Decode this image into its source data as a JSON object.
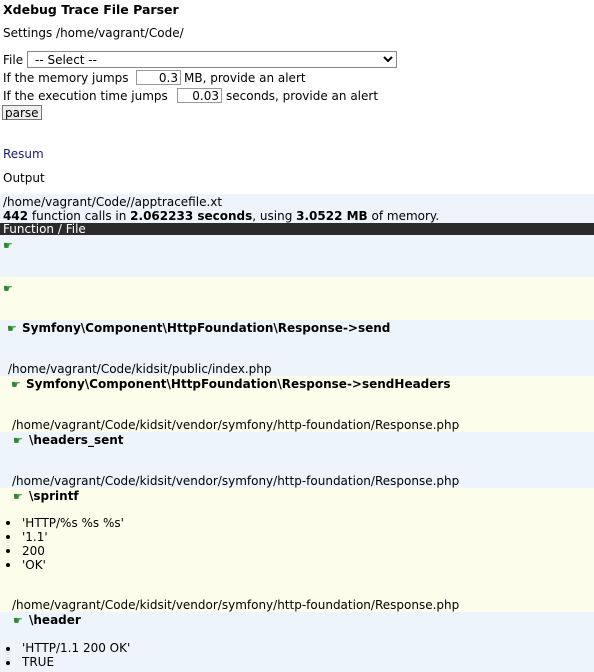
{
  "app": {
    "title": "Xdebug Trace File Parser"
  },
  "settings_line": "Settings /home/vagrant/Code/",
  "form": {
    "file_label": "File",
    "file_select": "-- Select --",
    "memory_label": "If the memory jumps",
    "memory_value": "0.3",
    "memory_suffix": "MB, provide an alert",
    "time_label": "If the execution time jumps",
    "time_value": "0.03",
    "time_suffix": "seconds, provide an alert",
    "parse_label": "parse"
  },
  "resum_link": "Resum",
  "output_label": "Output",
  "summary": {
    "path": "/home/vagrant/Code//apptracefile.xt",
    "calls": "442",
    "calls_text": " function calls in ",
    "seconds": "2.062233 seconds",
    "using_text": ", using ",
    "memory": "3.0522 MB",
    "memory_text": " of memory."
  },
  "table_header": "Function / File",
  "trace": [
    {
      "function": "Symfony\\Component\\HttpFoundation\\Response->send",
      "file": "/home/vagrant/Code/kidsit/public/index.php"
    },
    {
      "function": "Symfony\\Component\\HttpFoundation\\Response->sendHeaders",
      "file": "/home/vagrant/Code/kidsit/vendor/symfony/http-foundation/Response.php"
    },
    {
      "function": "\\headers_sent",
      "file": "/home/vagrant/Code/kidsit/vendor/symfony/http-foundation/Response.php"
    },
    {
      "function": "\\sprintf",
      "args": [
        "'HTTP/%s %s %s'",
        "'1.1'",
        "200",
        "'OK'"
      ],
      "file": "/home/vagrant/Code/kidsit/vendor/symfony/http-foundation/Response.php"
    },
    {
      "function": "\\header",
      "args": [
        "'HTTP/1.1 200 OK'",
        "TRUE"
      ]
    }
  ],
  "colors": {
    "row_blue": "#eef4fb",
    "row_cream": "#fdfdeb",
    "header_bg": "#2b2b2b",
    "hand_icon": "#2a8a2a",
    "link": "#1a1a7a"
  },
  "icons": {
    "row_marker": "pointing-hand-icon"
  }
}
